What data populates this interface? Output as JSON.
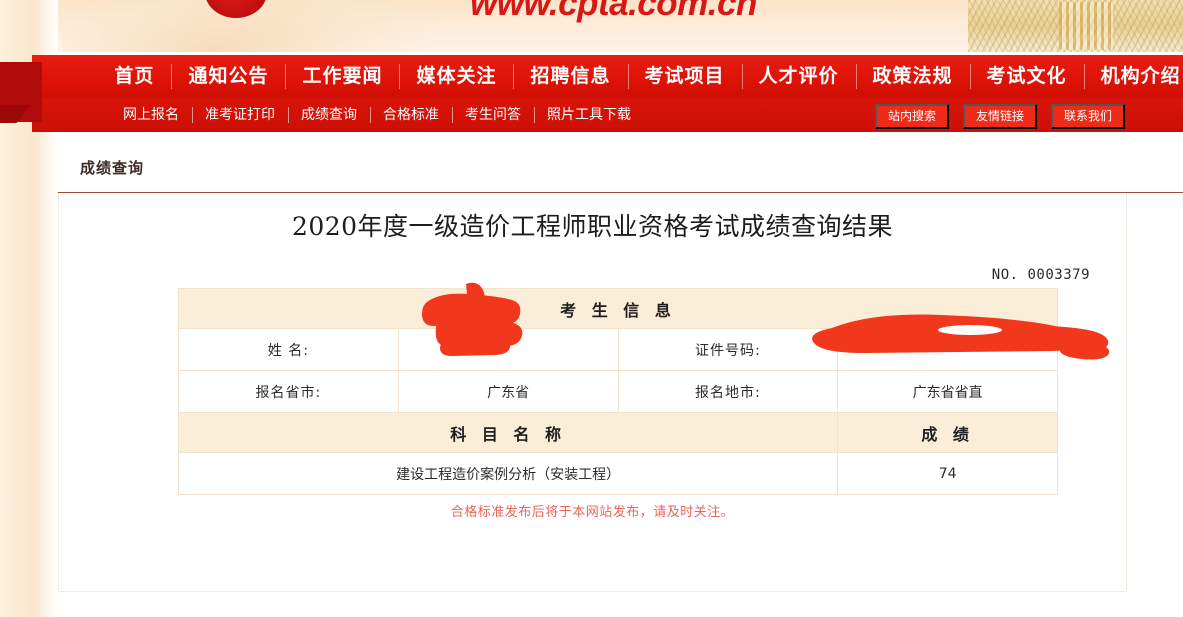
{
  "banner": {
    "site_url": "www.cpta.com.cn"
  },
  "nav": {
    "items": [
      {
        "label": "首页"
      },
      {
        "label": "通知公告"
      },
      {
        "label": "工作要闻"
      },
      {
        "label": "媒体关注"
      },
      {
        "label": "招聘信息"
      },
      {
        "label": "考试项目"
      },
      {
        "label": "人才评价"
      },
      {
        "label": "政策法规"
      },
      {
        "label": "考试文化"
      },
      {
        "label": "机构介绍"
      }
    ]
  },
  "subnav": {
    "items": [
      {
        "label": "网上报名"
      },
      {
        "label": "准考证打印"
      },
      {
        "label": "成绩查询"
      },
      {
        "label": "合格标准"
      },
      {
        "label": "考生问答"
      },
      {
        "label": "照片工具下载"
      }
    ],
    "buttons": [
      {
        "label": "站内搜索"
      },
      {
        "label": "友情链接"
      },
      {
        "label": "联系我们"
      }
    ]
  },
  "breadcrumb": {
    "label": "成绩查询"
  },
  "result": {
    "title": "2020年度一级造价工程师职业资格考试成绩查询结果",
    "serial_no": "NO. 0003379",
    "candidate_section_header": "考 生 信 息",
    "fields": {
      "name_label": "姓   名:",
      "name_value": "",
      "id_label": "证件号码:",
      "id_value": "",
      "province_label": "报名省市:",
      "province_value": "广东省",
      "city_label": "报名地市:",
      "city_value": "广东省省直"
    },
    "score_header": {
      "subject": "科 目 名 称",
      "score": "成  绩"
    },
    "scores": [
      {
        "subject": "建设工程造价案例分析（安装工程）",
        "score": "74"
      }
    ],
    "footnote": "合格标准发布后将于本网站发布，请及时关注。"
  },
  "colors": {
    "nav_red": "#e01308",
    "subnav_red": "#cf0f05",
    "button_red": "#ef2a18",
    "header_cream": "#fbeed8",
    "redaction_red": "#f2381c",
    "footnote_red": "#e8655a",
    "rule_red": "#9c4a3c"
  }
}
